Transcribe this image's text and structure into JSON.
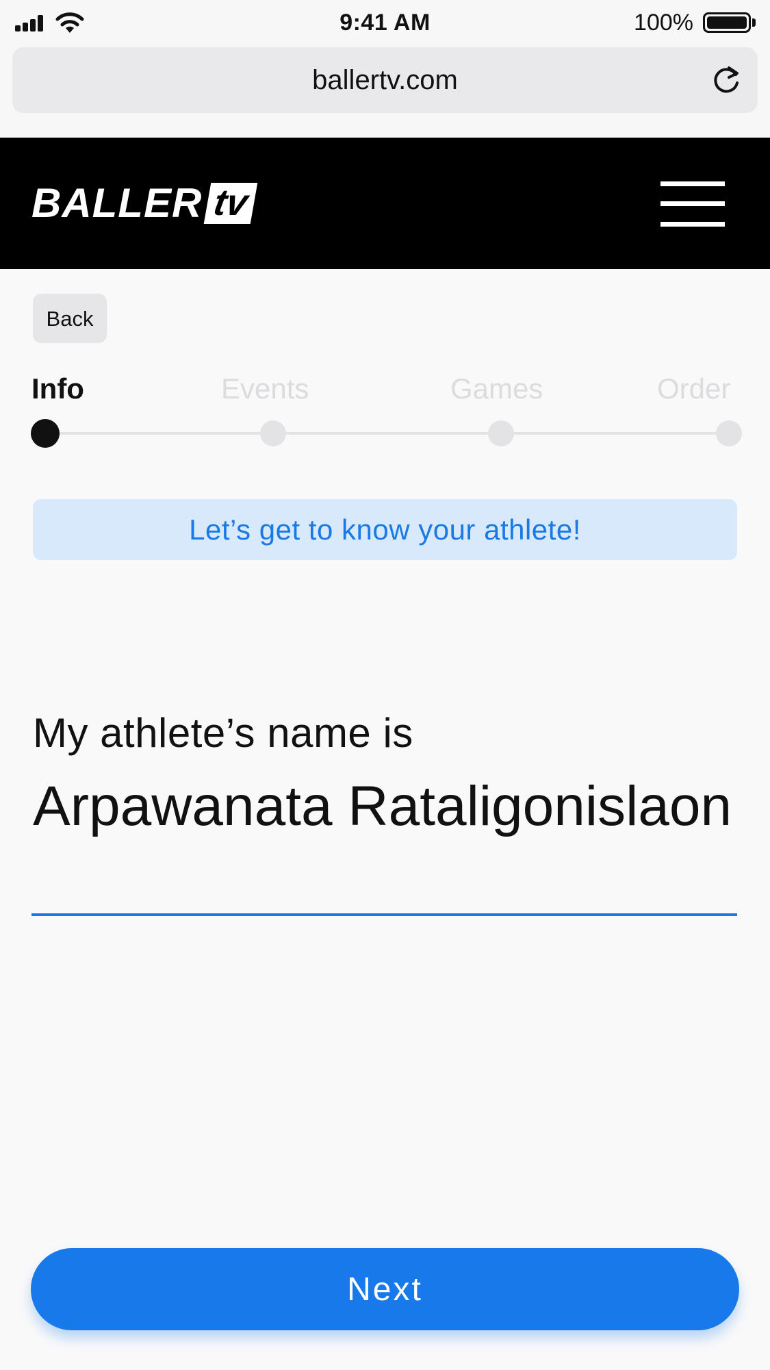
{
  "status_bar": {
    "time": "9:41 AM",
    "battery_percent": "100%",
    "battery_level": 1.0,
    "icons": [
      "signal-icon",
      "wifi-icon",
      "battery-icon"
    ]
  },
  "browser": {
    "url": "ballertv.com",
    "reload_icon": "reload-icon"
  },
  "header": {
    "logo_main": "BALLER",
    "logo_badge": "tv",
    "menu_icon": "hamburger-menu-icon"
  },
  "back_label": "Back",
  "stepper": {
    "steps": [
      {
        "label": "Info",
        "active": true
      },
      {
        "label": "Events",
        "active": false
      },
      {
        "label": "Games",
        "active": false
      },
      {
        "label": "Order",
        "active": false
      }
    ]
  },
  "banner_text": "Let’s get to know your athlete!",
  "prompt": "My athlete’s name is",
  "athlete_name": {
    "value": "Arpawanata Rataligonislaon",
    "placeholder": ""
  },
  "next_label": "Next",
  "colors": {
    "accent": "#1779ea",
    "banner_bg": "#d7e9fb",
    "header_bg": "#000000"
  }
}
